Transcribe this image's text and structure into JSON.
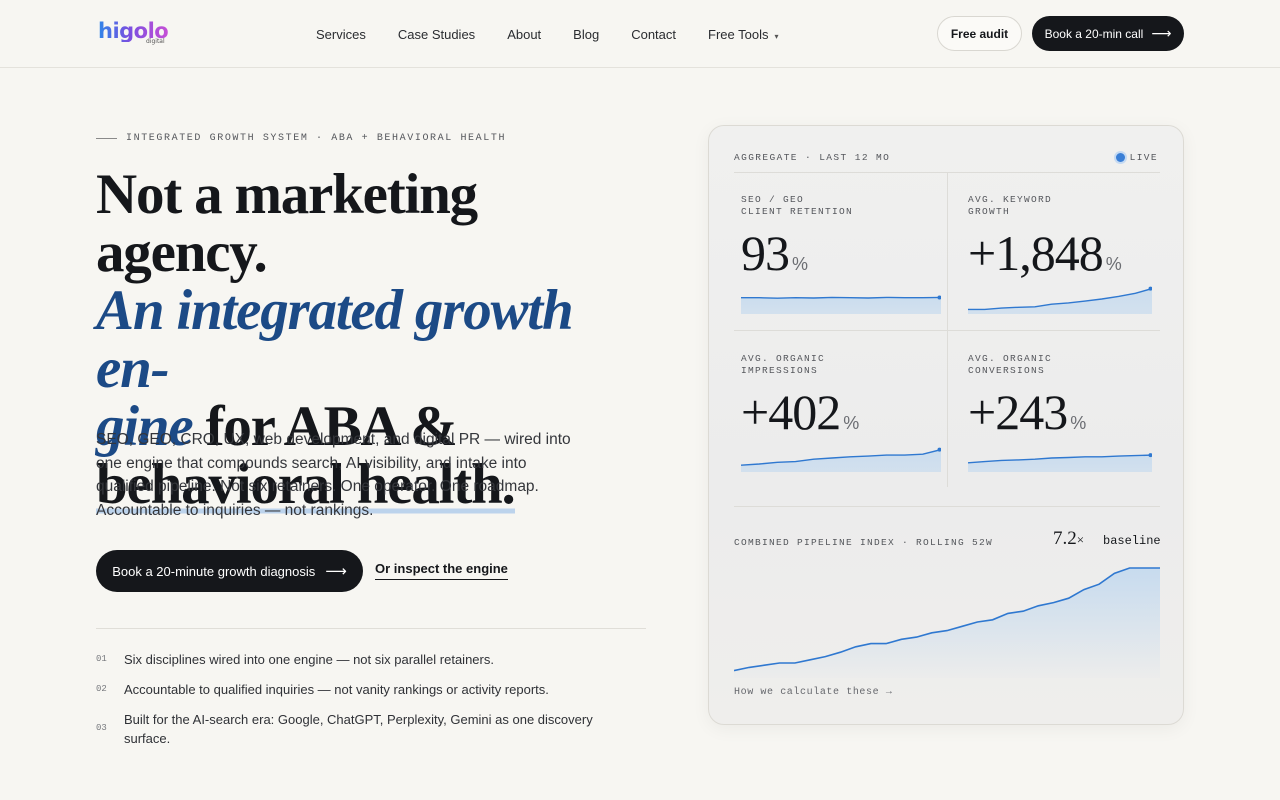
{
  "brand": {
    "name": "higolo",
    "sub": "digital"
  },
  "nav": {
    "items": [
      "Services",
      "Case Studies",
      "About",
      "Blog",
      "Contact",
      "Free Tools"
    ],
    "chevron": "⌄"
  },
  "header_cta": {
    "audit": "Free audit",
    "call": "Book a 20-min call",
    "arrow": "⟶"
  },
  "hero": {
    "eyebrow": "INTEGRATED GROWTH SYSTEM · ABA + BEHAVIORAL HEALTH",
    "headline_1": "Not a marketing agency.",
    "headline_2": "An integrated growth en-",
    "headline_3a": "gine",
    "headline_3b": " for ABA &",
    "headline_4": "behavioral health.",
    "lead": "SEO, GEO, CRO, UX, web development, and digital PR — wired into one engine that compounds search, AI visibility, and intake into qualified pipeline. Not six retainers. One operator. One roadmap. Accountable to inquiries — not rankings.",
    "cta_primary": "Book a 20-minute growth diagnosis",
    "cta_arrow": "⟶",
    "cta_secondary": "Or inspect the engine",
    "points": [
      {
        "num": "01",
        "text": "Six disciplines wired into one engine — not six parallel retainers."
      },
      {
        "num": "02",
        "text": "Accountable to qualified inquiries — not vanity rankings or activity reports."
      },
      {
        "num": "03",
        "text": "Built for the AI-search era: Google, ChatGPT, Perplexity, Gemini as one discovery surface."
      }
    ]
  },
  "card": {
    "header": "AGGREGATE · LAST 12 MO",
    "live": "LIVE",
    "accent": "#2f78d0",
    "fill": "#c7dbee",
    "metrics": [
      {
        "label_1": "SEO / GEO",
        "label_2": "CLIENT RETENTION",
        "value": "93",
        "unit": "%",
        "trend": [
          0.55,
          0.55,
          0.53,
          0.55,
          0.54,
          0.56,
          0.55,
          0.54,
          0.56,
          0.55,
          0.55,
          0.56
        ]
      },
      {
        "label_1": "AVG. KEYWORD",
        "label_2": "GROWTH",
        "value": "+1,848",
        "unit": "%",
        "trend": [
          0.1,
          0.1,
          0.15,
          0.18,
          0.2,
          0.3,
          0.35,
          0.42,
          0.5,
          0.6,
          0.72,
          0.9
        ]
      },
      {
        "label_1": "AVG. ORGANIC",
        "label_2": "IMPRESSIONS",
        "value": "+402",
        "unit": "%",
        "trend": [
          0.2,
          0.25,
          0.32,
          0.35,
          0.45,
          0.5,
          0.55,
          0.58,
          0.62,
          0.62,
          0.66,
          0.85
        ]
      },
      {
        "label_1": "AVG. ORGANIC",
        "label_2": "CONVERSIONS",
        "value": "+243",
        "unit": "%",
        "trend": [
          0.3,
          0.35,
          0.4,
          0.42,
          0.45,
          0.5,
          0.52,
          0.55,
          0.55,
          0.58,
          0.6,
          0.62
        ]
      }
    ],
    "pipeline": {
      "label": "COMBINED PIPELINE INDEX · ROLLING 52W",
      "value": "7.2",
      "value_suffix": "×",
      "baseline": "baseline",
      "series": [
        0.05,
        0.08,
        0.1,
        0.12,
        0.12,
        0.15,
        0.18,
        0.22,
        0.27,
        0.3,
        0.3,
        0.34,
        0.36,
        0.4,
        0.42,
        0.46,
        0.5,
        0.52,
        0.58,
        0.6,
        0.65,
        0.68,
        0.72,
        0.8,
        0.85,
        0.95,
        1.0,
        1.0,
        1.0
      ]
    },
    "calc_link": "How we calculate these →"
  }
}
